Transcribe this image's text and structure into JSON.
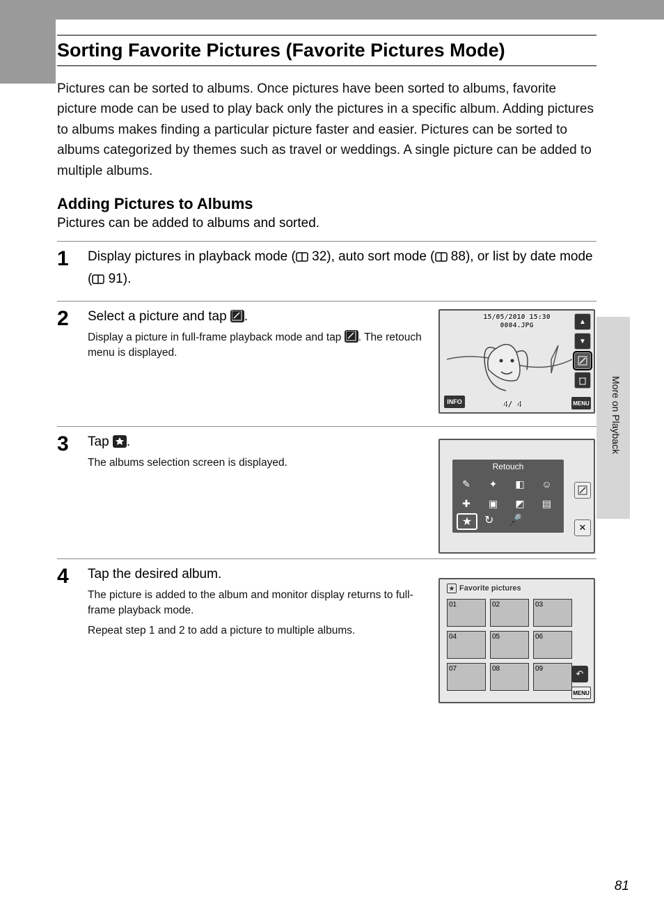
{
  "page": {
    "title": "Sorting Favorite Pictures (Favorite Pictures Mode)",
    "intro": "Pictures can be sorted to albums. Once pictures have been sorted to albums, favorite picture mode can be used to play back only the pictures in a specific album. Adding pictures to albums makes finding a particular picture faster and easier. Pictures can be sorted to albums categorized by themes such as travel or weddings. A single picture can be added to multiple albums.",
    "subheading": "Adding Pictures to Albums",
    "subtext": "Pictures can be added to albums and sorted.",
    "side_tab": "More on Playback",
    "page_number": "81"
  },
  "steps": {
    "s1": {
      "num": "1",
      "title_a": "Display pictures in playback mode (",
      "ref_a": "32",
      "title_b": "), auto sort mode (",
      "ref_b": "88",
      "title_c": "), or list by date mode (",
      "ref_c": "91",
      "title_d": ")."
    },
    "s2": {
      "num": "2",
      "title_a": "Select a picture and tap ",
      "title_b": ".",
      "desc_a": "Display a picture in full-frame playback mode and tap ",
      "desc_b": ". The retouch menu is displayed."
    },
    "s3": {
      "num": "3",
      "title_a": "Tap ",
      "title_b": ".",
      "desc": "The albums selection screen is displayed."
    },
    "s4": {
      "num": "4",
      "title": "Tap the desired album.",
      "desc1": "The picture is added to the album and monitor display returns to full-frame playback mode.",
      "desc2": "Repeat step 1 and 2 to add a picture to multiple albums."
    }
  },
  "screen1": {
    "date": "15/05/2010  15:30",
    "filename": "0004.JPG",
    "info": "INFO",
    "menu": "MENU",
    "counter": "4/    4"
  },
  "screen2": {
    "title": "Retouch"
  },
  "screen3": {
    "title": "Favorite pictures",
    "albums": [
      "01",
      "02",
      "03",
      "04",
      "05",
      "06",
      "07",
      "08",
      "09"
    ],
    "menu": "MENU"
  }
}
